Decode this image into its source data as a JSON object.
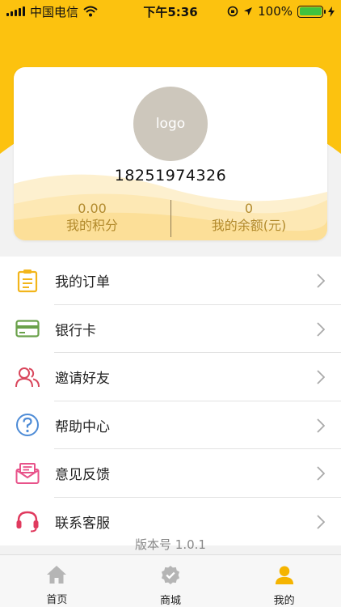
{
  "status_bar": {
    "carrier": "中国电信",
    "time": "下午5:36",
    "battery": "100%"
  },
  "profile": {
    "avatar_text": "logo",
    "phone": "18251974326",
    "points_value": "0.00",
    "points_label": "我的积分",
    "balance_value": "0",
    "balance_label": "我的余额(元)"
  },
  "menu": {
    "items": [
      {
        "label": "我的订单",
        "icon": "clipboard-icon",
        "color": "#f2b51b"
      },
      {
        "label": "银行卡",
        "icon": "bank-card-icon",
        "color": "#6aa14a"
      },
      {
        "label": "邀请好友",
        "icon": "invite-friends-icon",
        "color": "#d9465c"
      },
      {
        "label": "帮助中心",
        "icon": "help-icon",
        "color": "#4d8bd6"
      },
      {
        "label": "意见反馈",
        "icon": "feedback-icon",
        "color": "#e8538a"
      },
      {
        "label": "联系客服",
        "icon": "headset-icon",
        "color": "#e03a5e"
      }
    ]
  },
  "version": "版本号 1.0.1",
  "tabbar": {
    "tabs": [
      {
        "label": "首页",
        "icon": "home-icon"
      },
      {
        "label": "商城",
        "icon": "shop-badge-icon"
      },
      {
        "label": "我的",
        "icon": "user-icon"
      }
    ],
    "active_color": "#f5b400"
  },
  "colors": {
    "brand_yellow": "#fcc20f",
    "stat_text": "#b28a2c"
  }
}
